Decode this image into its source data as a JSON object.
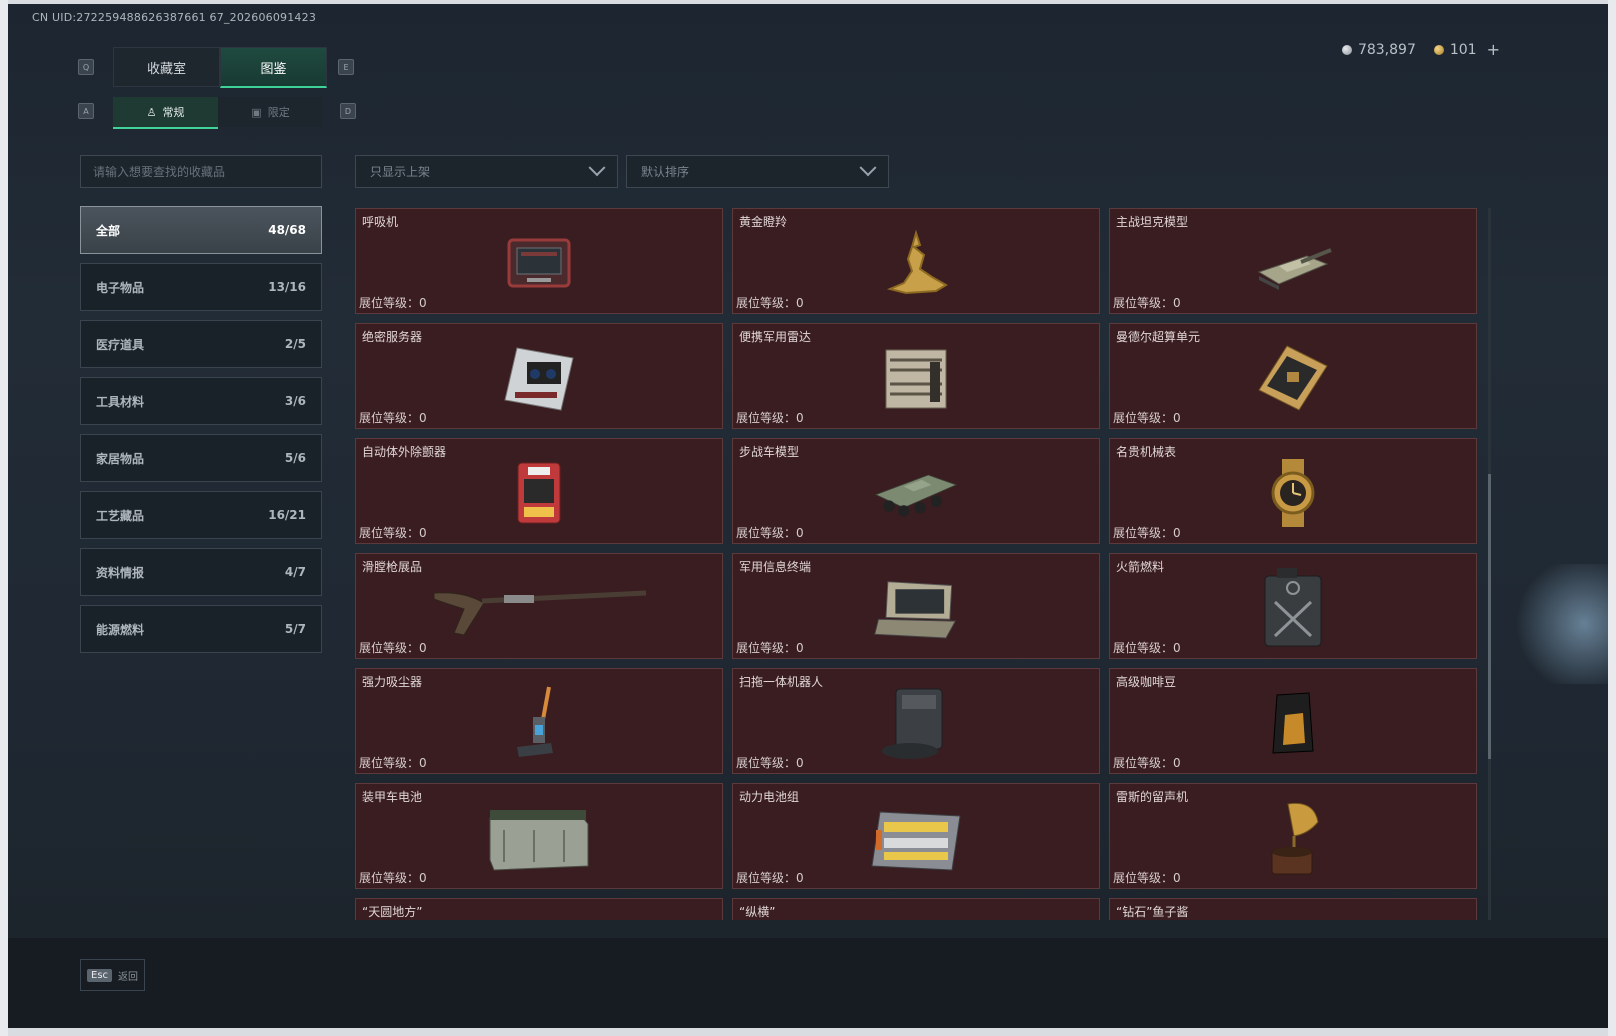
{
  "uid": "CN UID:272259488626387661 67_202606091423",
  "currency": {
    "silver": "783,897",
    "gold": "101",
    "add": "+"
  },
  "keys": {
    "q": "Q",
    "e": "E",
    "a": "A",
    "d": "D"
  },
  "tabs_main": [
    {
      "label": "收藏室",
      "active": false
    },
    {
      "label": "图鉴",
      "active": true
    }
  ],
  "tabs_sub": [
    {
      "label": "常规",
      "active": true
    },
    {
      "label": "限定",
      "active": false
    }
  ],
  "search": {
    "placeholder": "请输入想要查找的收藏品"
  },
  "filters": {
    "shelf": "只显示上架",
    "sort": "默认排序"
  },
  "categories": [
    {
      "label": "全部",
      "count": "48/68",
      "active": true
    },
    {
      "label": "电子物品",
      "count": "13/16"
    },
    {
      "label": "医疗道具",
      "count": "2/5"
    },
    {
      "label": "工具材料",
      "count": "3/6"
    },
    {
      "label": "家居物品",
      "count": "5/6"
    },
    {
      "label": "工艺藏品",
      "count": "16/21"
    },
    {
      "label": "资料情报",
      "count": "4/7"
    },
    {
      "label": "能源燃料",
      "count": "5/7"
    }
  ],
  "items": [
    {
      "name": "呼吸机",
      "level": "展位等级：0",
      "icon": "ventilator-icon"
    },
    {
      "name": "黄金瞪羚",
      "level": "展位等级：0",
      "icon": "golden-gazelle-icon"
    },
    {
      "name": "主战坦克模型",
      "level": "展位等级：0",
      "icon": "tank-model-icon"
    },
    {
      "name": "绝密服务器",
      "level": "展位等级：0",
      "icon": "server-icon"
    },
    {
      "name": "便携军用雷达",
      "level": "展位等级：0",
      "icon": "radar-icon"
    },
    {
      "name": "曼德尔超算单元",
      "level": "展位等级：0",
      "icon": "cpu-icon"
    },
    {
      "name": "自动体外除颤器",
      "level": "展位等级：0",
      "icon": "defibrillator-icon"
    },
    {
      "name": "步战车模型",
      "level": "展位等级：0",
      "icon": "ifv-model-icon"
    },
    {
      "name": "名贵机械表",
      "level": "展位等级：0",
      "icon": "watch-icon"
    },
    {
      "name": "滑膛枪展品",
      "level": "展位等级：0",
      "icon": "musket-icon"
    },
    {
      "name": "军用信息终端",
      "level": "展位等级：0",
      "icon": "terminal-icon"
    },
    {
      "name": "火箭燃料",
      "level": "展位等级：0",
      "icon": "fuel-canister-icon"
    },
    {
      "name": "强力吸尘器",
      "level": "展位等级：0",
      "icon": "vacuum-icon"
    },
    {
      "name": "扫拖一体机器人",
      "level": "展位等级：0",
      "icon": "robot-vacuum-icon"
    },
    {
      "name": "高级咖啡豆",
      "level": "展位等级：0",
      "icon": "coffee-bag-icon"
    },
    {
      "name": "装甲车电池",
      "level": "展位等级：0",
      "icon": "battery-icon"
    },
    {
      "name": "动力电池组",
      "level": "展位等级：0",
      "icon": "battery-pack-icon"
    },
    {
      "name": "雷斯的留声机",
      "level": "展位等级：0",
      "icon": "gramophone-icon"
    },
    {
      "name": "“天圆地方”",
      "level": "",
      "icon": ""
    },
    {
      "name": "“纵横”",
      "level": "",
      "icon": ""
    },
    {
      "name": "“钻石”鱼子酱",
      "level": "",
      "icon": ""
    }
  ],
  "footer": {
    "key": "Esc",
    "label": "返回"
  }
}
